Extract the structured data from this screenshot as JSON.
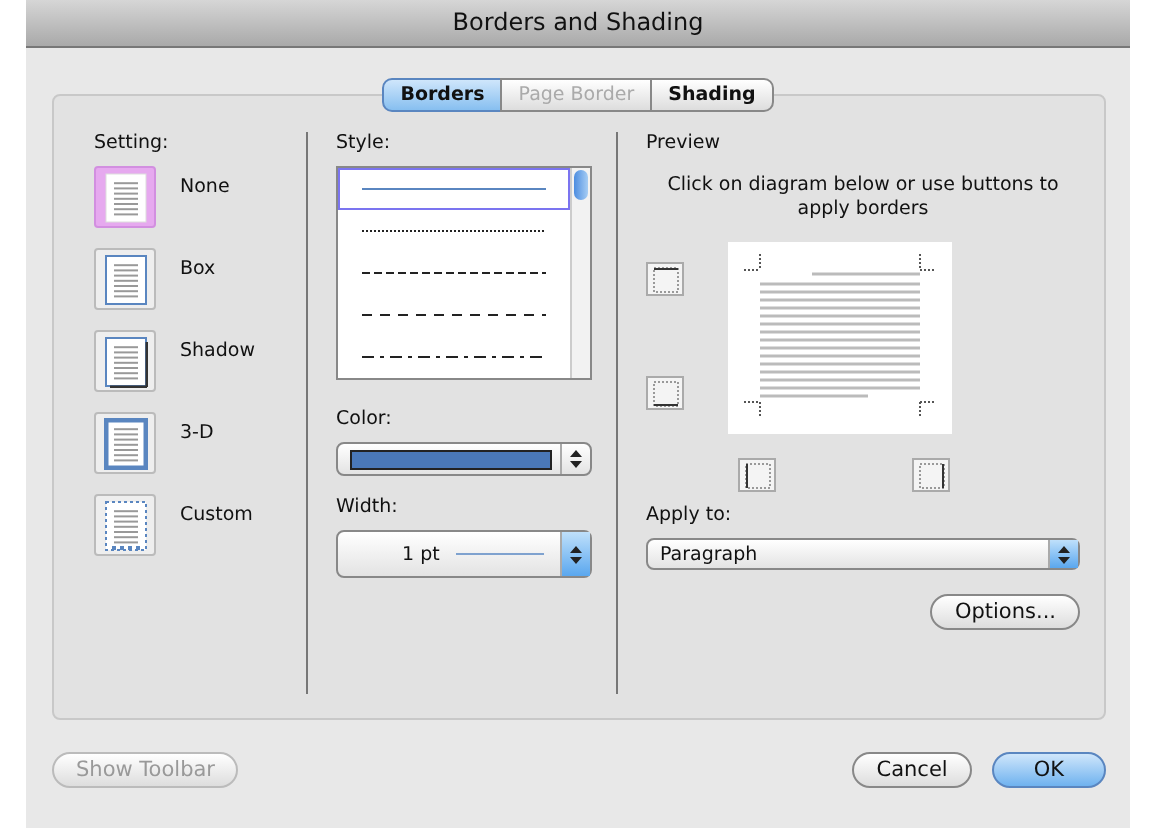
{
  "window": {
    "title": "Borders and Shading"
  },
  "tabs": [
    {
      "label": "Borders",
      "selected": true,
      "disabled": false
    },
    {
      "label": "Page Border",
      "selected": false,
      "disabled": true
    },
    {
      "label": "Shading",
      "selected": false,
      "disabled": false
    }
  ],
  "setting": {
    "label": "Setting:",
    "items": [
      {
        "kind": "none",
        "label": "None",
        "selected": true
      },
      {
        "kind": "box",
        "label": "Box",
        "selected": false
      },
      {
        "kind": "shadow",
        "label": "Shadow",
        "selected": false
      },
      {
        "kind": "threed",
        "label": "3-D",
        "selected": false
      },
      {
        "kind": "custom",
        "label": "Custom",
        "selected": false
      }
    ]
  },
  "style": {
    "label": "Style:",
    "items": [
      {
        "kind": "solid",
        "selected": true
      },
      {
        "kind": "dotted",
        "selected": false
      },
      {
        "kind": "small-dash",
        "selected": false
      },
      {
        "kind": "dash",
        "selected": false
      },
      {
        "kind": "dash-dot",
        "selected": false
      }
    ]
  },
  "color": {
    "label": "Color:",
    "color": "#4a78b8"
  },
  "width": {
    "label": "Width:",
    "value": "1 pt"
  },
  "preview": {
    "label": "Preview",
    "hint": "Click on diagram below or use buttons to apply borders"
  },
  "apply_to": {
    "label": "Apply to:",
    "value": "Paragraph"
  },
  "options_button": "Options...",
  "footer": {
    "toolbar_button": {
      "label": "Show Toolbar",
      "disabled": true
    },
    "cancel": "Cancel",
    "ok": "OK"
  }
}
